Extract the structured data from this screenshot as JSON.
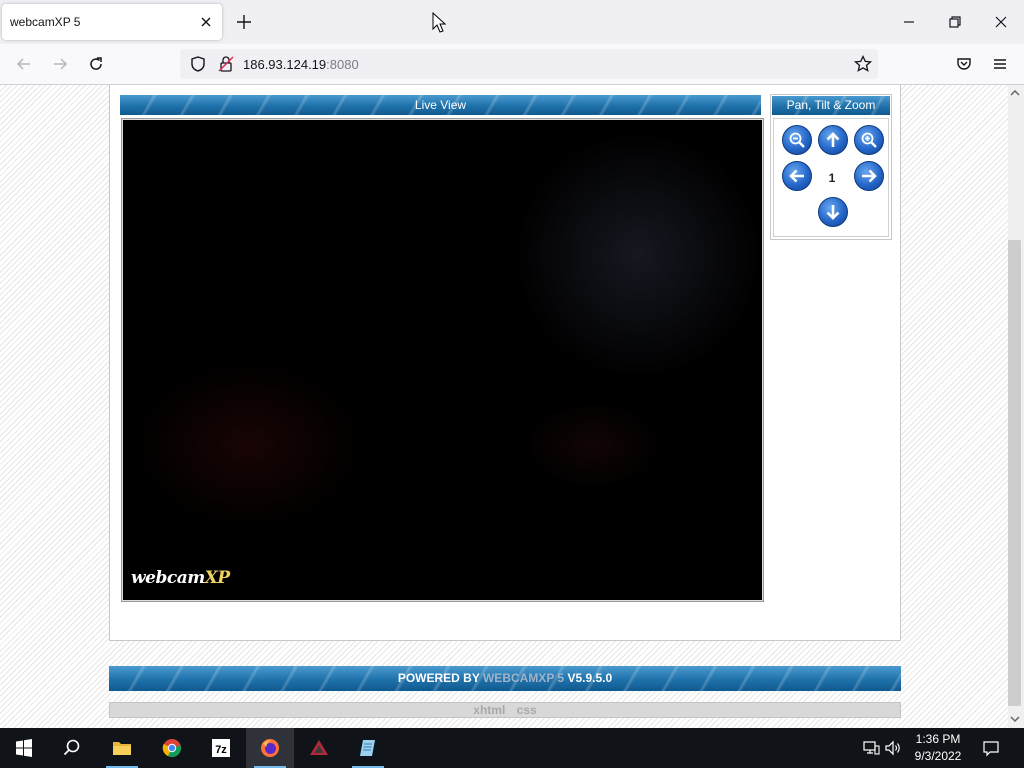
{
  "browser": {
    "tab_title": "webcamXP 5",
    "url_host": "186.93.124.19",
    "url_port": ":8080"
  },
  "page": {
    "live_view_title": "Live View",
    "ptz_title": "Pan, Tilt & Zoom",
    "preset_number": "1",
    "video_logo_main": "webcam",
    "video_logo_accent": "XP",
    "footer_powered_by": "POWERED BY",
    "footer_brand": "WEBCAMXP 5",
    "footer_version": "V5.9.5.0",
    "footer_link_xhtml": "xhtml",
    "footer_link_css": "css"
  },
  "taskbar": {
    "time": "1:36 PM",
    "date": "9/3/2022",
    "apps": [
      "start",
      "search",
      "file-explorer",
      "chrome",
      "7zip",
      "firefox",
      "app-triangle",
      "app-notepad"
    ]
  },
  "colors": {
    "header_blue": "#1a6aa3",
    "footer_brand_gray": "#9fb3c8",
    "taskbar_bg": "#101418",
    "taskbar_accent": "#76b9ed"
  }
}
